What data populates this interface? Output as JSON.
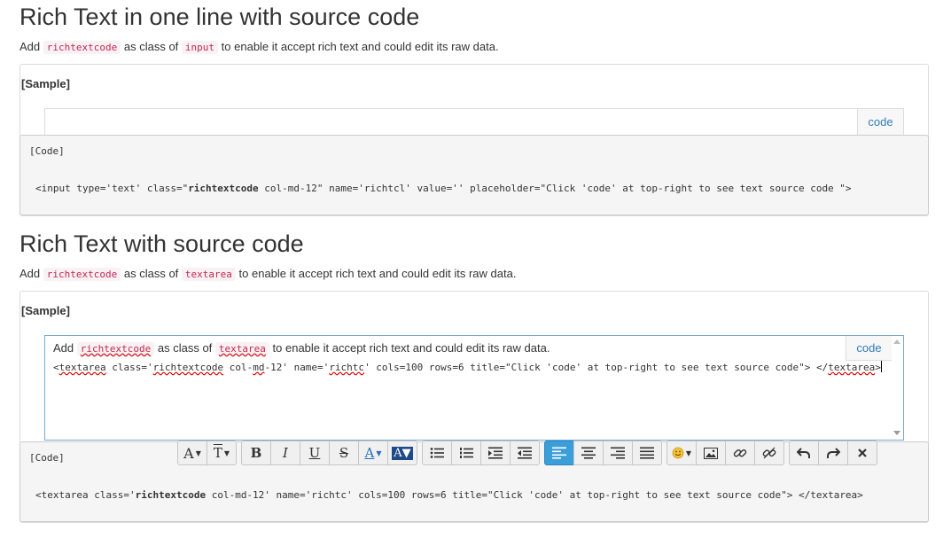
{
  "section1": {
    "title": "Rich Text in one line with source code",
    "desc_prefix": "Add",
    "desc_class_kw": "richtextcode",
    "desc_mid": "as class of",
    "desc_el_kw": "input",
    "desc_suffix": "to enable it accept rich text and could edit its raw data.",
    "sample_label": "[Sample]",
    "code_button": "code",
    "code_label": "[Code]",
    "code_pre": "<input type='text' class=\"",
    "code_bold": "richtextcode",
    "code_post": " col-md-12\" name='richtcl' value='' placeholder=\"Click 'code' at top-right to see text source code \">"
  },
  "section2": {
    "title": "Rich Text with source code",
    "desc_prefix": "Add",
    "desc_class_kw": "richtextcode",
    "desc_mid": "as class of",
    "desc_el_kw": "textarea",
    "desc_suffix": "to enable it accept rich text and could edit its raw data.",
    "sample_label": "[Sample]",
    "code_button": "code",
    "editor": {
      "line1_a": "Add",
      "line1_kw1": "richtextcode",
      "line1_b": "as class of",
      "line1_kw2": "textarea",
      "line1_c": "to enable it accept rich text and could edit its raw data.",
      "l2_1": "<",
      "l2_2": "textarea",
      "l2_3": " class='",
      "l2_4": "richtextcode",
      "l2_5": " col-",
      "l2_6": "md",
      "l2_7": "-12' name='",
      "l2_8": "richtc",
      "l2_9": "' cols=100 rows=6 title=\"Click 'code' at top-right to see text source code\"> </",
      "l2_10": "textarea",
      "l2_11": ">"
    },
    "code_label": "[Code]",
    "code_pre": "<textarea class='",
    "code_bold": "richtextcode",
    "code_post": " col-md-12' name='richtc' cols=100 rows=6 title=\"Click 'code' at top-right to see text source code\"> </textarea>"
  },
  "toolbar": {
    "groups": [
      [
        "font-size-icon",
        "font-type-icon"
      ],
      [
        "bold-icon",
        "italic-icon",
        "underline-icon",
        "strikethrough-icon",
        "font-color-icon",
        "background-color-icon"
      ],
      [
        "unordered-list-icon",
        "ordered-list-icon",
        "indent-icon",
        "outdent-icon"
      ],
      [
        "align-left-icon",
        "align-center-icon",
        "align-right-icon",
        "justify-icon"
      ],
      [
        "emoji-icon",
        "image-icon",
        "link-icon",
        "unlink-icon"
      ],
      [
        "undo-icon",
        "redo-icon",
        "remove-icon"
      ]
    ],
    "active": "align-left-icon",
    "accent_color": "#3a9fd8"
  },
  "colors": {
    "keyword": "#c7254e",
    "keyword_bg": "#f9f2f4",
    "link": "#337ab7",
    "editor_border": "#7aa7d8"
  }
}
